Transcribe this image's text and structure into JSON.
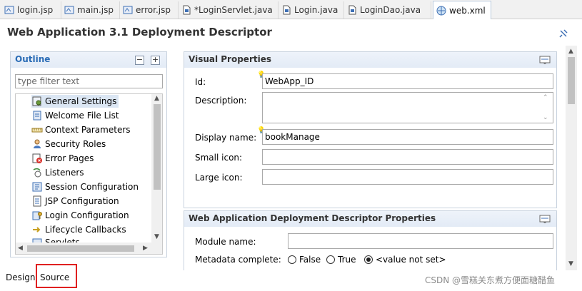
{
  "tabs": [
    {
      "label": "login.jsp",
      "icon": "jsp-file-icon"
    },
    {
      "label": "main.jsp",
      "icon": "jsp-file-icon"
    },
    {
      "label": "error.jsp",
      "icon": "jsp-file-icon"
    },
    {
      "label": "*LoginServlet.java",
      "icon": "java-file-icon"
    },
    {
      "label": "Login.java",
      "icon": "java-file-icon"
    },
    {
      "label": "LoginDao.java",
      "icon": "java-file-icon"
    },
    {
      "label": "web.xml",
      "icon": "xml-file-icon",
      "active": true,
      "close": "✕"
    }
  ],
  "editor": {
    "title": "Web Application 3.1 Deployment Descriptor"
  },
  "outline": {
    "title": "Outline",
    "collapse_glyph": "−",
    "expand_glyph": "+",
    "filter_placeholder": "type filter text",
    "items": [
      {
        "label": "General Settings",
        "icon": "settings-icon",
        "selected": true
      },
      {
        "label": "Welcome File List",
        "icon": "welcome-file-icon"
      },
      {
        "label": "Context Parameters",
        "icon": "context-params-icon"
      },
      {
        "label": "Security Roles",
        "icon": "security-roles-icon"
      },
      {
        "label": "Error Pages",
        "icon": "error-pages-icon"
      },
      {
        "label": "Listeners",
        "icon": "listeners-icon"
      },
      {
        "label": "Session Configuration",
        "icon": "session-config-icon"
      },
      {
        "label": "JSP Configuration",
        "icon": "jsp-config-icon"
      },
      {
        "label": "Login Configuration",
        "icon": "login-config-icon"
      },
      {
        "label": "Lifecycle Callbacks",
        "icon": "lifecycle-icon"
      },
      {
        "label": "Servlets",
        "icon": "servlets-icon"
      }
    ]
  },
  "visual_properties": {
    "title": "Visual Properties",
    "id_label": "Id:",
    "id_value": "WebApp_ID",
    "description_label": "Description:",
    "description_value": "",
    "display_name_label": "Display name:",
    "display_name_value": "bookManage",
    "small_icon_label": "Small icon:",
    "small_icon_value": "",
    "large_icon_label": "Large icon:",
    "large_icon_value": ""
  },
  "dd_properties": {
    "title": "Web Application Deployment Descriptor Properties",
    "module_name_label": "Module name:",
    "module_name_value": "",
    "metadata_label": "Metadata complete:",
    "options": [
      {
        "label": "False",
        "selected": false
      },
      {
        "label": "True",
        "selected": false
      },
      {
        "label": "<value not set>",
        "selected": true
      }
    ]
  },
  "bottom_tabs": {
    "design": "Design",
    "source": "Source"
  },
  "watermark": "CSDN @雪糕关东煮方便面糖醋鱼",
  "colors": {
    "accent": "#2a6cb6",
    "highlight": "#e02020",
    "selected_row": "#dbe6f3"
  }
}
